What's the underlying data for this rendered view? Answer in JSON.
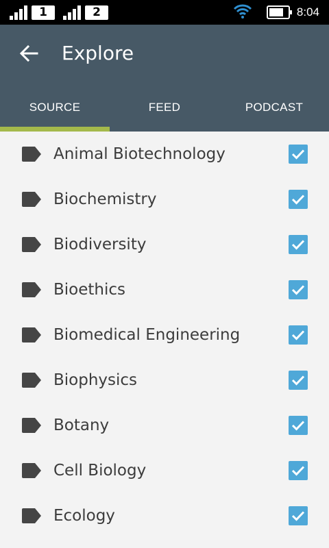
{
  "status_bar": {
    "sim1": "1",
    "sim2": "2",
    "time": "8:04"
  },
  "header": {
    "title": "Explore",
    "back_icon": "arrow-back-icon"
  },
  "tabs": [
    {
      "label": "SOURCE",
      "active": true
    },
    {
      "label": "FEED",
      "active": false
    },
    {
      "label": "PODCAST",
      "active": false
    }
  ],
  "colors": {
    "app_bar": "#475966",
    "active_tab_indicator": "#a4b94b",
    "checkbox": "#4fa8d8"
  },
  "items": [
    {
      "label": "Animal Biotechnology",
      "checked": true,
      "icon": "tag-icon"
    },
    {
      "label": "Biochemistry",
      "checked": true,
      "icon": "tag-icon"
    },
    {
      "label": "Biodiversity",
      "checked": true,
      "icon": "tag-icon"
    },
    {
      "label": "Bioethics",
      "checked": true,
      "icon": "tag-icon"
    },
    {
      "label": "Biomedical Engineering",
      "checked": true,
      "icon": "tag-icon"
    },
    {
      "label": "Biophysics",
      "checked": true,
      "icon": "tag-icon"
    },
    {
      "label": "Botany",
      "checked": true,
      "icon": "tag-icon"
    },
    {
      "label": "Cell Biology",
      "checked": true,
      "icon": "tag-icon"
    },
    {
      "label": "Ecology",
      "checked": true,
      "icon": "tag-icon"
    }
  ]
}
